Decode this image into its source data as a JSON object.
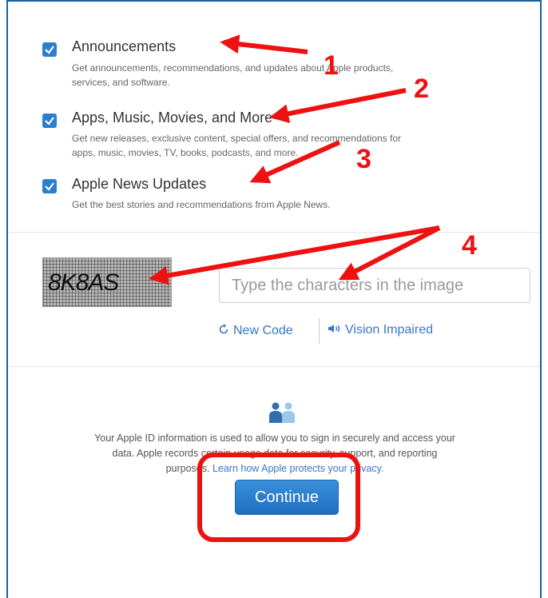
{
  "options": [
    {
      "title": "Announcements",
      "desc_lines": [
        "Get announcements, recommendations, and updates about Apple products,",
        "services, and software."
      ]
    },
    {
      "title": "Apps, Music, Movies, and More",
      "desc_lines": [
        "Get new releases, exclusive content, special offers, and recommendations for",
        "apps, music, movies, TV, books, podcasts, and more."
      ]
    },
    {
      "title": "Apple News Updates",
      "desc_lines": [
        "Get the best stories and recommendations from Apple News."
      ]
    }
  ],
  "captcha": {
    "image_text": "8K8AS",
    "input_placeholder": "Type the characters in the image",
    "new_code_label": "New Code",
    "vision_impaired_label": "Vision Impaired"
  },
  "privacy": {
    "text_lines": [
      "Your Apple ID information is used to allow you to sign in securely and access your",
      "data. Apple records certain usage data for security, support, and reporting"
    ],
    "line3_prefix": "purposes.",
    "link_text": "Learn how Apple protects your privacy."
  },
  "continue_label": "Continue",
  "annotations": [
    "1",
    "2",
    "3",
    "4"
  ],
  "colors": {
    "accent": "#2c7fce",
    "annotation": "#ee1111",
    "link": "#3577c9"
  }
}
